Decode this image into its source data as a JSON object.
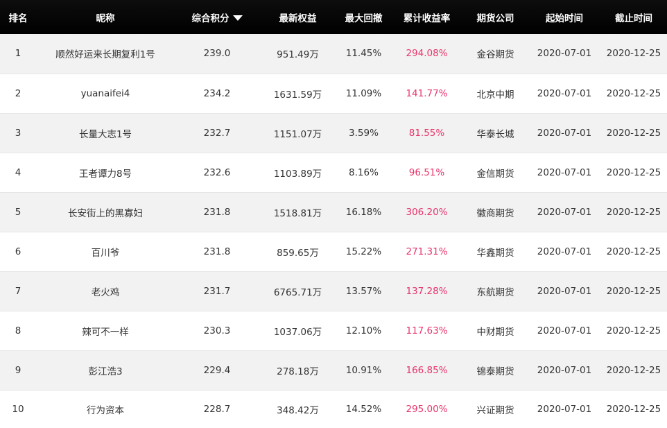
{
  "header": {
    "rank": "排名",
    "nickname": "昵称",
    "score": "综合积分",
    "equity": "最新权益",
    "drawdown": "最大回撤",
    "return_rate": "累计收益率",
    "company": "期货公司",
    "start": "起始时间",
    "end": "截止时间"
  },
  "rows": [
    {
      "rank": "1",
      "nickname": "顺然好运来长期复利1号",
      "score": "239.0",
      "equity": "951.49万",
      "drawdown": "11.45%",
      "return_rate": "294.08%",
      "company": "金谷期货",
      "start": "2020-07-01",
      "end": "2020-12-25"
    },
    {
      "rank": "2",
      "nickname": "yuanaifei4",
      "score": "234.2",
      "equity": "1631.59万",
      "drawdown": "11.09%",
      "return_rate": "141.77%",
      "company": "北京中期",
      "start": "2020-07-01",
      "end": "2020-12-25"
    },
    {
      "rank": "3",
      "nickname": "长量大志1号",
      "score": "232.7",
      "equity": "1151.07万",
      "drawdown": "3.59%",
      "return_rate": "81.55%",
      "company": "华泰长城",
      "start": "2020-07-01",
      "end": "2020-12-25"
    },
    {
      "rank": "4",
      "nickname": "王者谭力8号",
      "score": "232.6",
      "equity": "1103.89万",
      "drawdown": "8.16%",
      "return_rate": "96.51%",
      "company": "金信期货",
      "start": "2020-07-01",
      "end": "2020-12-25"
    },
    {
      "rank": "5",
      "nickname": "长安街上的黑寡妇",
      "score": "231.8",
      "equity": "1518.81万",
      "drawdown": "16.18%",
      "return_rate": "306.20%",
      "company": "徽商期货",
      "start": "2020-07-01",
      "end": "2020-12-25"
    },
    {
      "rank": "6",
      "nickname": "百川爷",
      "score": "231.8",
      "equity": "859.65万",
      "drawdown": "15.22%",
      "return_rate": "271.31%",
      "company": "华鑫期货",
      "start": "2020-07-01",
      "end": "2020-12-25"
    },
    {
      "rank": "7",
      "nickname": "老火鸡",
      "score": "231.7",
      "equity": "6765.71万",
      "drawdown": "13.57%",
      "return_rate": "137.28%",
      "company": "东航期货",
      "start": "2020-07-01",
      "end": "2020-12-25"
    },
    {
      "rank": "8",
      "nickname": "辣可不一样",
      "score": "230.3",
      "equity": "1037.06万",
      "drawdown": "12.10%",
      "return_rate": "117.63%",
      "company": "中财期货",
      "start": "2020-07-01",
      "end": "2020-12-25"
    },
    {
      "rank": "9",
      "nickname": "彭江浩3",
      "score": "229.4",
      "equity": "278.18万",
      "drawdown": "10.91%",
      "return_rate": "166.85%",
      "company": "锦泰期货",
      "start": "2020-07-01",
      "end": "2020-12-25"
    },
    {
      "rank": "10",
      "nickname": "行为资本",
      "score": "228.7",
      "equity": "348.42万",
      "drawdown": "14.52%",
      "return_rate": "295.00%",
      "company": "兴证期货",
      "start": "2020-07-01",
      "end": "2020-12-25"
    }
  ],
  "colors": {
    "header_bg": "#000000",
    "row_alt_bg": "#f2f2f2",
    "rate_text": "#e8336b"
  },
  "icons": {
    "sort": "sort-desc-triangle-icon"
  }
}
